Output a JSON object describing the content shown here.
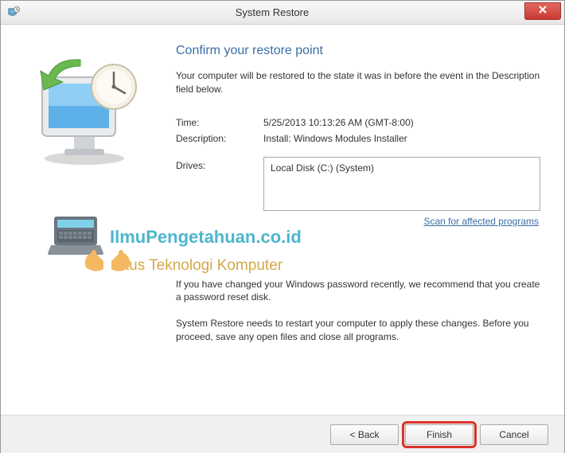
{
  "titlebar": {
    "title": "System Restore",
    "close": "✕"
  },
  "main": {
    "heading": "Confirm your restore point",
    "intro": "Your computer will be restored to the state it was in before the event in the Description field below.",
    "time_label": "Time:",
    "time_value": "5/25/2013 10:13:26 AM (GMT-8:00)",
    "desc_label": "Description:",
    "desc_value": "Install: Windows Modules Installer",
    "drives_label": "Drives:",
    "drives_value": "Local Disk (C:) (System)",
    "scan_link": "Scan for affected programs",
    "note1": "If you have changed your Windows password recently, we recommend that you create a password reset disk.",
    "note2": "System Restore needs to restart your computer to apply these changes. Before you proceed, save any open files and close all programs."
  },
  "footer": {
    "back": "< Back",
    "finish": "Finish",
    "cancel": "Cancel"
  },
  "watermark": {
    "title": "IlmuPengetahuan.co.id",
    "subtitle": "Situs Teknologi Komputer"
  }
}
